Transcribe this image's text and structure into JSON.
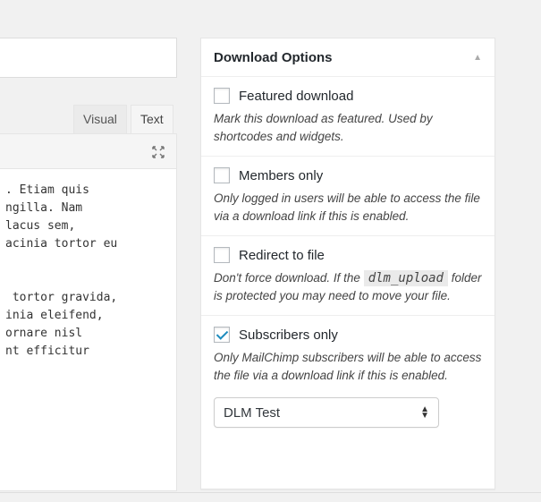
{
  "editor": {
    "tabs": [
      {
        "label": "Visual"
      },
      {
        "label": "Text"
      }
    ],
    "lines_top": [
      ". Etiam quis",
      "ngilla. Nam",
      "lacus sem,",
      "acinia tortor eu"
    ],
    "lines_bottom": [
      " tortor gravida,",
      "inia eleifend,",
      "ornare nisl",
      "nt efficitur"
    ]
  },
  "metabox": {
    "title": "Download Options",
    "options": [
      {
        "label": "Featured download",
        "checked": false,
        "desc": "Mark this download as featured. Used by shortcodes and widgets."
      },
      {
        "label": "Members only",
        "checked": false,
        "desc": "Only logged in users will be able to access the file via a download link if this is enabled."
      },
      {
        "label": "Redirect to file",
        "checked": false,
        "desc_before": "Don't force download. If the",
        "desc_code": "dlm_upload",
        "desc_after": "folder is protected you may need to move your file."
      },
      {
        "label": "Subscribers only",
        "checked": true,
        "desc": "Only MailChimp subscribers will be able to access the file via a download link if this is enabled."
      }
    ],
    "select": {
      "value": "DLM Test"
    }
  },
  "icons": {
    "fullscreen": "fullscreen-icon",
    "collapse": "triangle-up-icon",
    "select": "updown-arrows-icon"
  },
  "colors": {
    "accent": "#1e8cbe",
    "background": "#f1f1f1"
  }
}
